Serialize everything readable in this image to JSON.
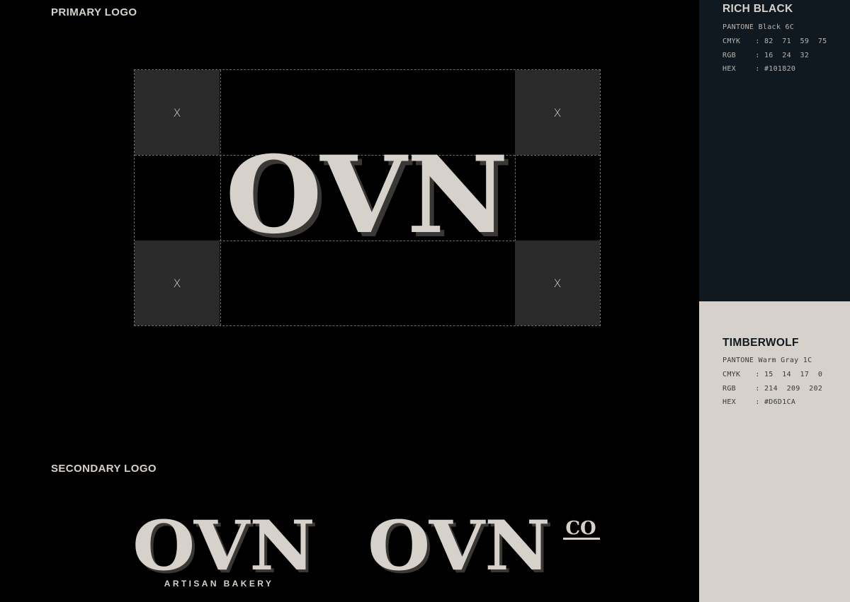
{
  "sections": {
    "primary_title": "PRIMARY LOGO",
    "secondary_title": "SECONDARY LOGO"
  },
  "primary_logo": {
    "wordmark": "OVN",
    "clearspace_marker": "X"
  },
  "secondary_logos": [
    {
      "wordmark": "OVN",
      "tagline": "ARTISAN BAKERY"
    },
    {
      "wordmark": "OVN",
      "superscript": "CO"
    }
  ],
  "colors": [
    {
      "name": "RICH BLACK",
      "hex_value": "#101820",
      "specs": [
        {
          "key": "PANTONE",
          "sep": " ",
          "value": "Black 6C"
        },
        {
          "key": "CMYK",
          "sep": " : ",
          "value": "82  71  59  75"
        },
        {
          "key": "RGB",
          "sep": " : ",
          "value": "16  24  32"
        },
        {
          "key": "HEX",
          "sep": " : ",
          "value": "#101820"
        }
      ]
    },
    {
      "name": "TIMBERWOLF",
      "hex_value": "#D6D1CA",
      "specs": [
        {
          "key": "PANTONE",
          "sep": " ",
          "value": "Warm Gray 1C"
        },
        {
          "key": "CMYK",
          "sep": " : ",
          "value": "15  14  17  0"
        },
        {
          "key": "RGB",
          "sep": " : ",
          "value": "214  209  202"
        },
        {
          "key": "HEX",
          "sep": " : ",
          "value": "#D6D1CA"
        }
      ]
    }
  ],
  "palette": {
    "background": "#000000",
    "logo_fill": "#D6D1CA",
    "grid_cell": "#2A2A2A"
  }
}
